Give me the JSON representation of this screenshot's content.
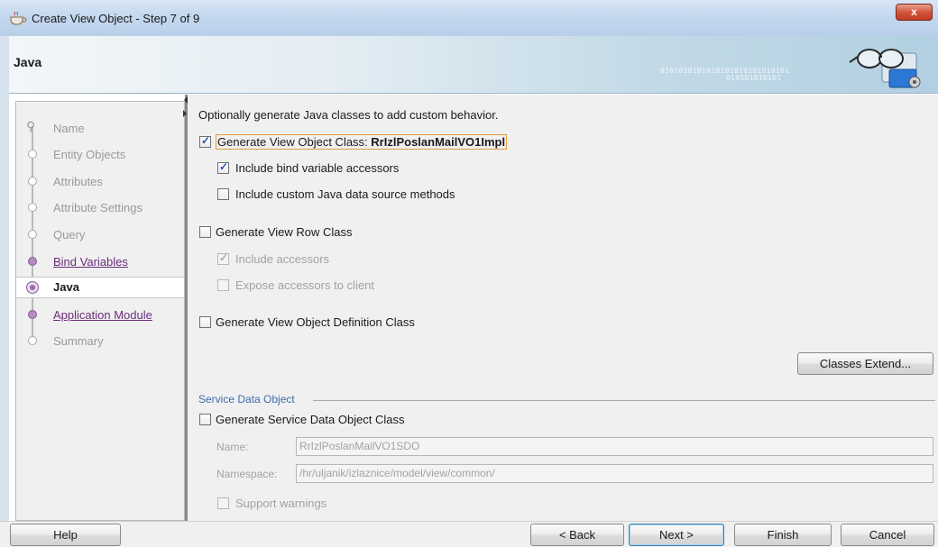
{
  "window": {
    "title": "Create View Object - Step 7 of 9",
    "close_label": "x"
  },
  "header": {
    "title": "Java",
    "binary_text_1": "0101010101010101010101010101",
    "binary_text_2": "010101010101"
  },
  "nav": {
    "items": [
      {
        "label": "Name",
        "state": "pending"
      },
      {
        "label": "Entity Objects",
        "state": "pending"
      },
      {
        "label": "Attributes",
        "state": "pending"
      },
      {
        "label": "Attribute Settings",
        "state": "pending"
      },
      {
        "label": "Query",
        "state": "pending"
      },
      {
        "label": "Bind Variables",
        "state": "visited"
      },
      {
        "label": "Java",
        "state": "active"
      },
      {
        "label": "Application Module",
        "state": "visited"
      },
      {
        "label": "Summary",
        "state": "pending"
      }
    ]
  },
  "content": {
    "intro": "Optionally generate Java classes to add custom behavior.",
    "view_object_class": {
      "label": "Generate View Object Class: ",
      "class_name": "RrIzlPoslanMailVO1Impl",
      "checked": true
    },
    "bind_variable_accessors": {
      "label": "Include bind variable accessors",
      "checked": true
    },
    "custom_data_source": {
      "label": "Include custom Java data source methods",
      "checked": false
    },
    "view_row_class": {
      "label": "Generate View Row Class",
      "checked": false
    },
    "include_accessors": {
      "label": "Include accessors",
      "checked": true,
      "enabled": false
    },
    "expose_accessors": {
      "label": "Expose accessors to client",
      "checked": false,
      "enabled": false
    },
    "definition_class": {
      "label": "Generate View Object Definition Class",
      "checked": false
    },
    "classes_extend_button": "Classes Extend...",
    "sdo": {
      "section_title": "Service Data Object",
      "generate_label": "Generate Service Data Object Class",
      "generate_checked": false,
      "name_label": "Name:",
      "name_value": "RrIzlPoslanMailVO1SDO",
      "namespace_label": "Namespace:",
      "namespace_value": "/hr/uljanik/izlaznice/model/view/common/",
      "support_warnings_label": "Support warnings",
      "support_warnings_checked": false
    }
  },
  "footer": {
    "help": "Help",
    "back": "< Back",
    "next": "Next >",
    "finish": "Finish",
    "cancel": "Cancel"
  },
  "colors": {
    "accent_link": "#6b2d7a",
    "section_title": "#3f6ca8",
    "focus_border": "#e39b3d",
    "close_button": "#c13a22"
  }
}
